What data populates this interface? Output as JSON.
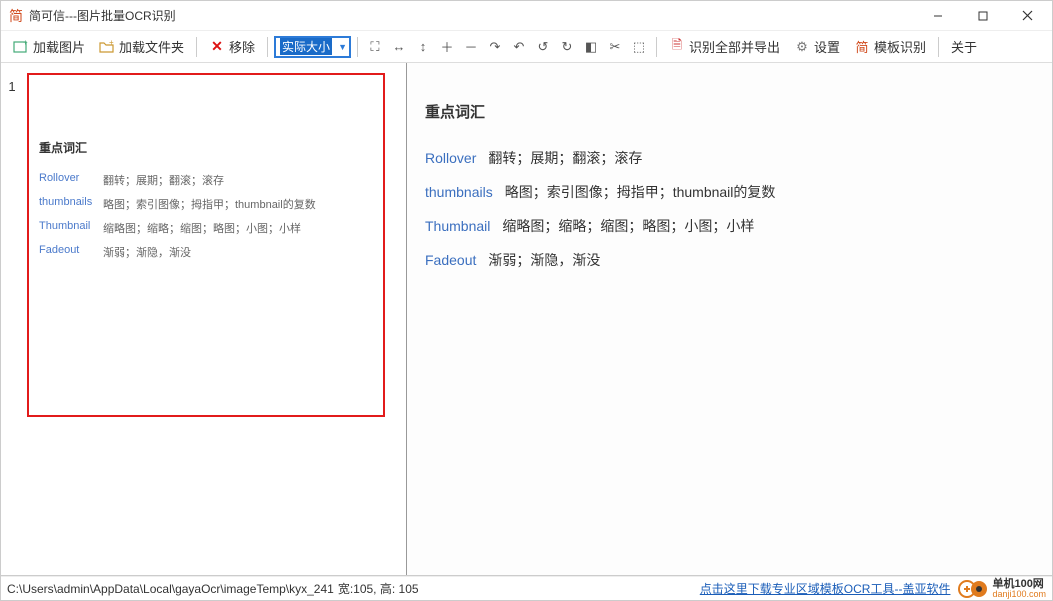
{
  "titlebar": {
    "title": "简可信---图片批量OCR识别"
  },
  "toolbar": {
    "load_image": "加载图片",
    "load_folder": "加载文件夹",
    "remove": "移除",
    "zoom_selected": "实际大小",
    "ocr_export": "识别全部并导出",
    "settings": "设置",
    "template_ocr": "模板识别",
    "about": "关于"
  },
  "left": {
    "index": "1",
    "title": "重点词汇",
    "rows": [
      {
        "term": "Rollover",
        "def": "翻转；展期；翻滚；滚存"
      },
      {
        "term": "thumbnails",
        "def": "略图；索引图像；拇指甲；thumbnail的复数"
      },
      {
        "term": "Thumbnail",
        "def": "缩略图；缩略；缩图；略图；小图；小样"
      },
      {
        "term": "Fadeout",
        "def": "渐弱；渐隐，渐没"
      }
    ]
  },
  "right": {
    "title": "重点词汇",
    "rows": [
      {
        "term": "Rollover",
        "def": "翻转；展期；翻滚；滚存"
      },
      {
        "term": "thumbnails",
        "def": "略图；索引图像；拇指甲；thumbnail的复数"
      },
      {
        "term": "Thumbnail",
        "def": "缩略图；缩略；缩图；略图；小图；小样"
      },
      {
        "term": "Fadeout",
        "def": "渐弱；渐隐，渐没"
      }
    ]
  },
  "statusbar": {
    "path": "C:\\Users\\admin\\AppData\\Local\\gayaOcr\\imageTemp\\kyx_241",
    "dims": "宽:105, 高: 105",
    "link": "点击这里下载专业区域模板OCR工具--盖亚软件",
    "logo_cn": "单机100网",
    "logo_url": "danji100.com"
  }
}
